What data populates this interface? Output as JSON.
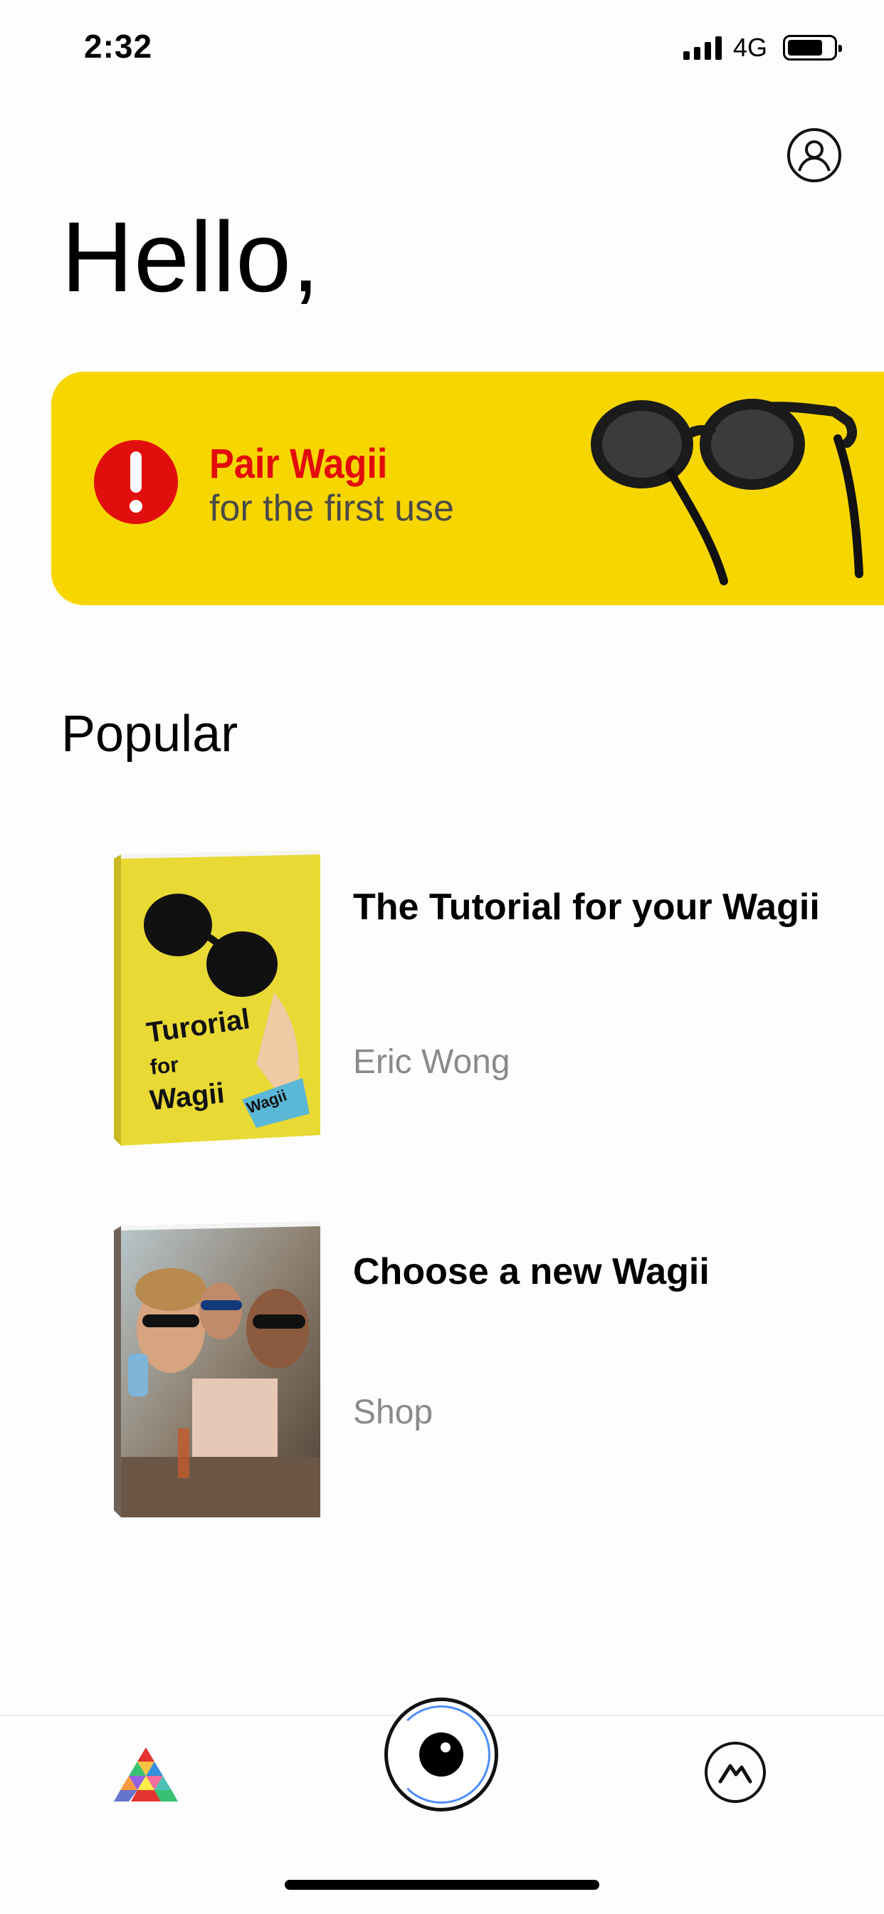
{
  "status_bar": {
    "time": "2:32",
    "network": "4G"
  },
  "greeting": "Hello,",
  "pair_banner": {
    "title": "Pair Wagii",
    "subtitle": "for the first use"
  },
  "popular": {
    "heading": "Popular",
    "items": [
      {
        "title": "The Tutorial for your Wagii",
        "subtitle": "Eric Wong",
        "cover_text": [
          "Turorial",
          "for",
          "Wagii"
        ],
        "cover_tag": "Wagii"
      },
      {
        "title": "Choose a new Wagii",
        "subtitle": "Shop"
      }
    ]
  },
  "colors": {
    "banner": "#f7d600",
    "alert": "#e10e0e",
    "accent_ring": "#4c8dff"
  },
  "icons": {
    "profile": "user-circle-icon",
    "home": "colorful-pyramid-icon",
    "camera": "eye-camera-icon",
    "explore": "mountain-circle-icon"
  }
}
